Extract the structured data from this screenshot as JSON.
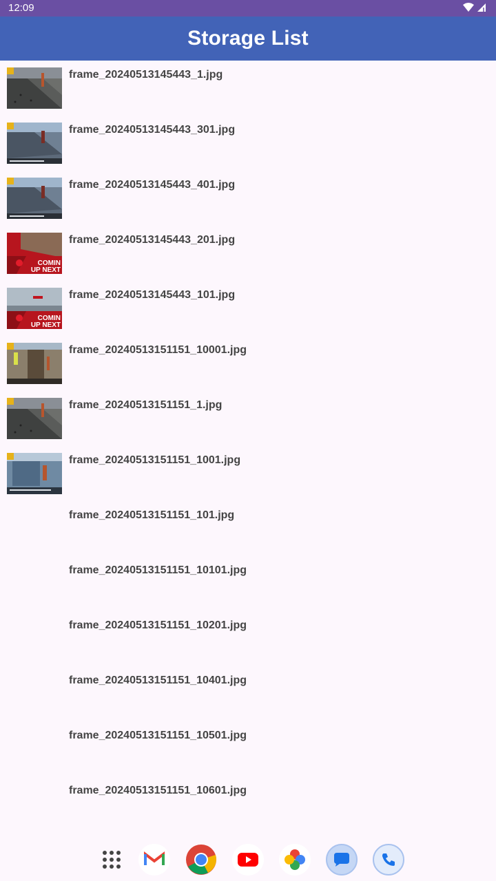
{
  "status": {
    "time": "12:09"
  },
  "appbar": {
    "title": "Storage List"
  },
  "files": [
    {
      "name": "frame_20240513145443_1.jpg",
      "thumb": "road-gray"
    },
    {
      "name": "frame_20240513145443_301.jpg",
      "thumb": "road-blue"
    },
    {
      "name": "frame_20240513145443_401.jpg",
      "thumb": "road-blue"
    },
    {
      "name": "frame_20240513145443_201.jpg",
      "thumb": "coming-red",
      "overlay": "COMIN UP NEXT"
    },
    {
      "name": "frame_20240513145443_101.jpg",
      "thumb": "coming-gray",
      "overlay": "COMIN UP NEXT"
    },
    {
      "name": "frame_20240513151151_10001.jpg",
      "thumb": "site-tan"
    },
    {
      "name": "frame_20240513151151_1.jpg",
      "thumb": "road-gray"
    },
    {
      "name": "frame_20240513151151_1001.jpg",
      "thumb": "site-blue"
    },
    {
      "name": "frame_20240513151151_101.jpg",
      "thumb": "none"
    },
    {
      "name": "frame_20240513151151_10101.jpg",
      "thumb": "none"
    },
    {
      "name": "frame_20240513151151_10201.jpg",
      "thumb": "none"
    },
    {
      "name": "frame_20240513151151_10401.jpg",
      "thumb": "none"
    },
    {
      "name": "frame_20240513151151_10501.jpg",
      "thumb": "none"
    },
    {
      "name": "frame_20240513151151_10601.jpg",
      "thumb": "none"
    }
  ],
  "dock": [
    {
      "name": "app-drawer-icon"
    },
    {
      "name": "gmail-icon"
    },
    {
      "name": "chrome-icon"
    },
    {
      "name": "youtube-icon"
    },
    {
      "name": "photos-icon"
    },
    {
      "name": "messages-icon"
    },
    {
      "name": "phone-icon"
    }
  ],
  "colors": {
    "statusbar": "#6a4fa3",
    "appbar": "#4263b7",
    "background": "#fdf7fd",
    "text": "#444444"
  }
}
